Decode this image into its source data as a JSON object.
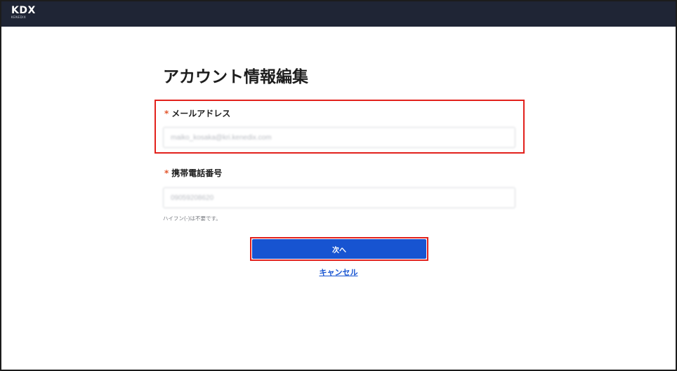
{
  "header": {
    "logo_text": "KDX",
    "logo_subtext": "KENEDIX"
  },
  "page": {
    "title": "アカウント情報編集"
  },
  "form": {
    "email": {
      "required_mark": "*",
      "label": "メールアドレス",
      "value": "maiko_kosaka@kri.kenedix.com"
    },
    "phone": {
      "required_mark": "*",
      "label": "携帯電話番号",
      "value": "09059208620",
      "helper": "ハイフン(-)は不要です。"
    },
    "next_label": "次へ",
    "cancel_label": "キャンセル"
  },
  "colors": {
    "header_bg": "#1f2535",
    "primary_button": "#1754d1",
    "required_mark": "#e2562c",
    "highlight_border": "#e2211c"
  }
}
